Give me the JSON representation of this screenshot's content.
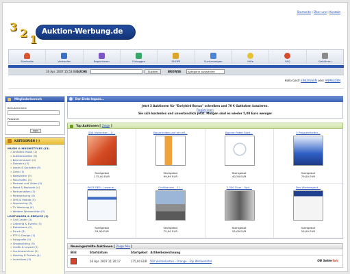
{
  "header": {
    "logo_digits": [
      "3",
      "2",
      "1"
    ],
    "logo_text": "Auktion-Werbung.de",
    "top_links": [
      "Startseite",
      "Über uns",
      "Kontakt"
    ]
  },
  "nav": [
    {
      "label": "Startseite",
      "icon": "home-icon",
      "color": "#d9532c"
    },
    {
      "label": "Verkaufen",
      "icon": "sell-icon",
      "color": "#3c6fc7"
    },
    {
      "label": "Registrieren",
      "icon": "register-icon",
      "color": "#7b55c4"
    },
    {
      "label": "Einloggen",
      "icon": "login-icon",
      "color": "#3aa56b"
    },
    {
      "label": "SHOPS",
      "icon": "shop-icon",
      "color": "#d9a62c"
    },
    {
      "label": "Suchanzeigen",
      "icon": "search-ads-icon",
      "color": "#4b86d6"
    },
    {
      "label": "Hilfe",
      "icon": "help-icon",
      "color": "#e8c133"
    },
    {
      "label": "FAQ",
      "icon": "faq-icon",
      "color": "#d64c2c"
    },
    {
      "label": "Gebühren",
      "icon": "fees-icon",
      "color": "#8a8a8a"
    }
  ],
  "search": {
    "datetime": "16 Apr. 2007 15:53:08",
    "search_label": "SUCHE",
    "search_value": "",
    "button_label": "Suchen",
    "browse_label": "BROWSE",
    "category_selected": "Kategorie auswählen"
  },
  "greeting": {
    "prefix": "Hallo Gast!",
    "login_link": "EINLOGGEN",
    "middle": "oder",
    "register_link": "ANMELDEN"
  },
  "sidebar": {
    "member_title": "Mitgliederbereich",
    "username_label": "Benutzername",
    "password_label": "Passwort",
    "login_button": "login",
    "categories_title": "KATEGORIEN (-)",
    "groups": [
      {
        "title": "MUSIK & MUSIKSTYLES (13)",
        "items": [
          "Ambient Musik (1)",
          "Auktionsseiten (8)",
          "Bannertausch (4)",
          "Domains (3)",
          "Leads & Kontakte (5)",
          "Links (1)",
          "Newsletter (5)",
          "Paid-Traffic (3)",
          "Podcast und Video (3)",
          "Paket & Postnetz (4)",
          "Partnerseiten (3)",
          "Reibwerbung (4)",
          "SMS & Mobile (5)",
          "Sponsoring (3)",
          "TV Werbung (4)",
          "Weitere Werbemittel (3)"
        ]
      },
      {
        "title": "LEISTUNGEN & SERVICE (2)",
        "items": [
          "Call Center (1)",
          "Catering & Events (3)",
          "Datenbank (1)",
          "Druck (3)",
          "FTP & Design (1)",
          "Fotografie (3)",
          "Shopbuilding (5)",
          "Grafik & Layout (3)",
          "Suchmaschinen (5)",
          "Hosting & Portals (4)",
          "Incentives (3)"
        ]
      }
    ]
  },
  "main": {
    "intro_title": "Der Erste Impuls...",
    "promo_line1": "Jetzt 3 Auktionen für \"Earlybird Bonus\" schreiben und 70 € Guthaben kassieren.",
    "promo_link": "Registrieren",
    "promo_line2": "Sie sich kostenlos und unverbindlich jetzt. Morgen sind es wieder 5,00 Euro weniger",
    "top_title": "Top Auktionen",
    "top_link": "Zeige",
    "top_items": [
      {
        "title": "500 Visitenkar... D...",
        "start_label": "Startgebot",
        "price": "175,00 EUR",
        "img": "cards"
      },
      {
        "title": "Bauscheiben auf ein eff...",
        "start_label": "Startgebot",
        "price": "99,99 EUR",
        "img": "flag"
      },
      {
        "title": "Banner Paket Start...",
        "start_label": "Startgebot",
        "price": "40,50 EUR",
        "img": "banner"
      },
      {
        "title": "5 Prospekthalter...",
        "start_label": "Startgebot",
        "price": "79,00 EUR",
        "img": "display"
      },
      {
        "title": "PAGE PEEL / www.w...",
        "start_label": "Startgebot",
        "price": "29,90 EUR",
        "img": "web"
      },
      {
        "title": "Großbanner - 11...",
        "start_label": "Startgebot",
        "price": "75,00 EUR",
        "img": "city"
      },
      {
        "title": "3-300 Flyer - Spd...",
        "start_label": "Startgebot",
        "price": "55,00 EUR",
        "img": "glass"
      },
      {
        "title": "Das Werbeagent...",
        "start_label": "Startgebot",
        "price": "29,00 EUR",
        "img": "site"
      }
    ],
    "new_title": "Neueingestellte Auktionen",
    "new_link": "Zeige Alle",
    "table_headers": [
      "Bild",
      "Startdatum",
      "Startgebot",
      "Artikelbezeichnung"
    ],
    "rows": [
      {
        "date": "16 Apr. 2007 11:20:17",
        "price": "175,00 EUR",
        "title": "500 Visitenkarten - Orange - Top Werbemittel",
        "seller_a": "OB",
        "seller_b": "Seller",
        "seller_c": "fair"
      }
    ]
  }
}
